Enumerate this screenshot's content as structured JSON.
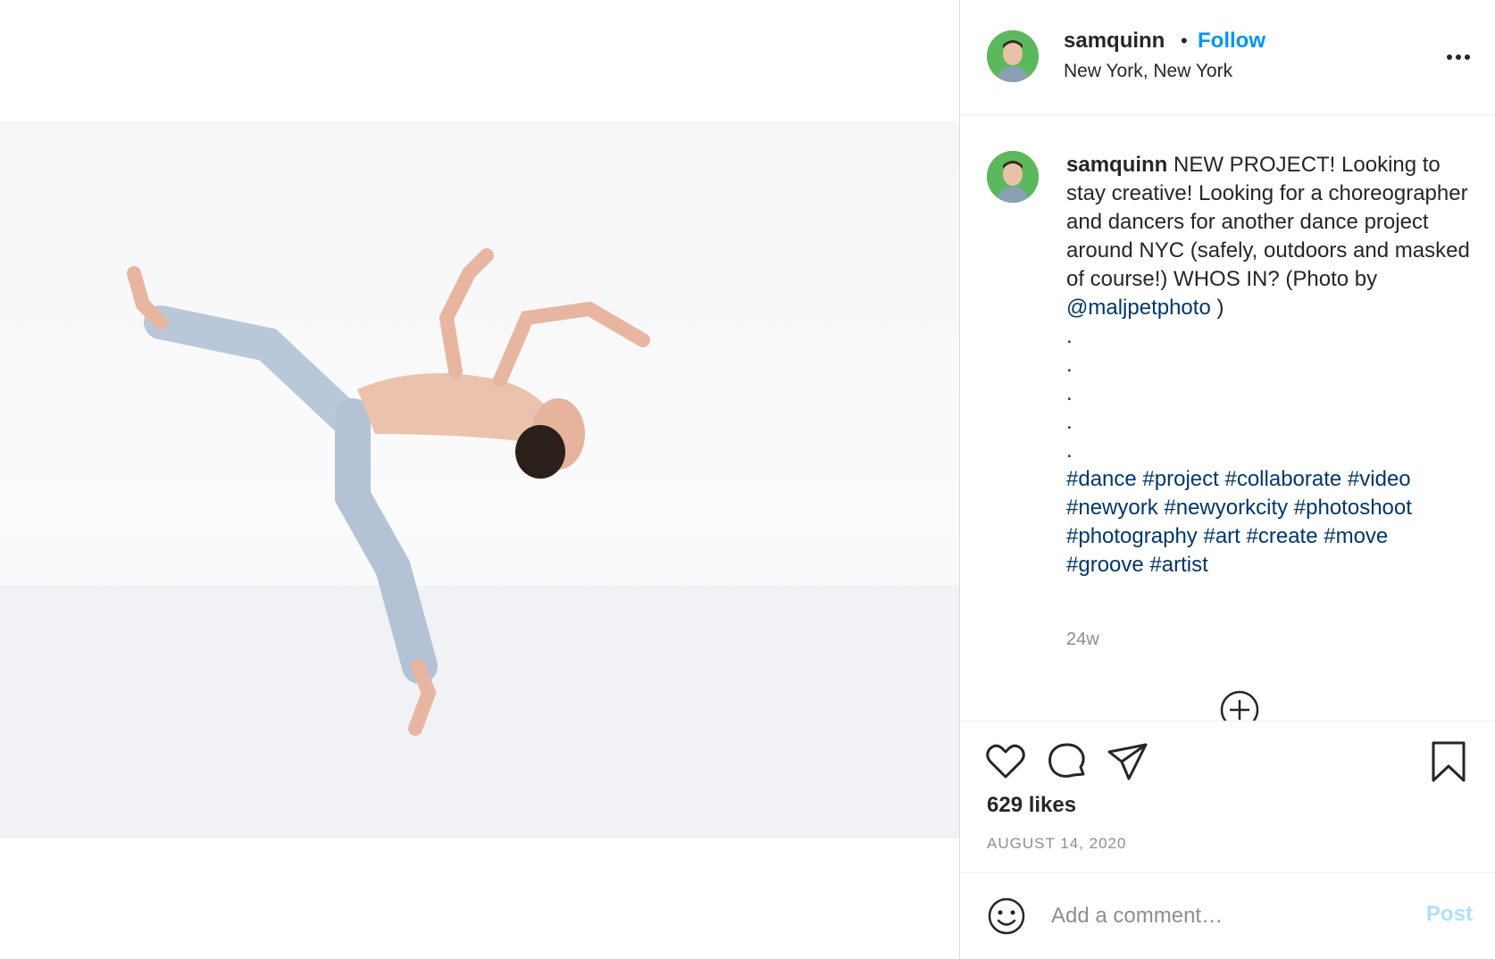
{
  "header": {
    "username": "samquinn",
    "separator": "•",
    "follow_label": "Follow",
    "location": "New York, New York",
    "more_icon": "more-horizontal-icon"
  },
  "post": {
    "media_description_icon": "dancer-photo",
    "caption": {
      "username": "samquinn",
      "text": "NEW PROJECT! Looking to stay creative! Looking for a choreographer and dancers for another dance project around NYC (safely, outdoors and masked of course!) WHOS IN? (Photo by",
      "mention": "@maljpetphoto",
      "mention_suffix": " )",
      "dots": [
        ".",
        ".",
        ".",
        ".",
        "."
      ],
      "hashtags": [
        "#dance",
        "#project",
        "#collaborate",
        "#video",
        "#newyork",
        "#newyorkcity",
        "#photoshoot",
        "#photography",
        "#art",
        "#create",
        "#move",
        "#groove",
        "#artist"
      ]
    },
    "age": "24w",
    "likes": "629 likes",
    "date": "AUGUST 14, 2020"
  },
  "comment": {
    "placeholder": "Add a comment…",
    "post_label": "Post"
  },
  "colors": {
    "accent": "#0095f6",
    "link": "#00376b",
    "muted": "#8e8e8e",
    "post_disabled": "#b2dffc"
  }
}
